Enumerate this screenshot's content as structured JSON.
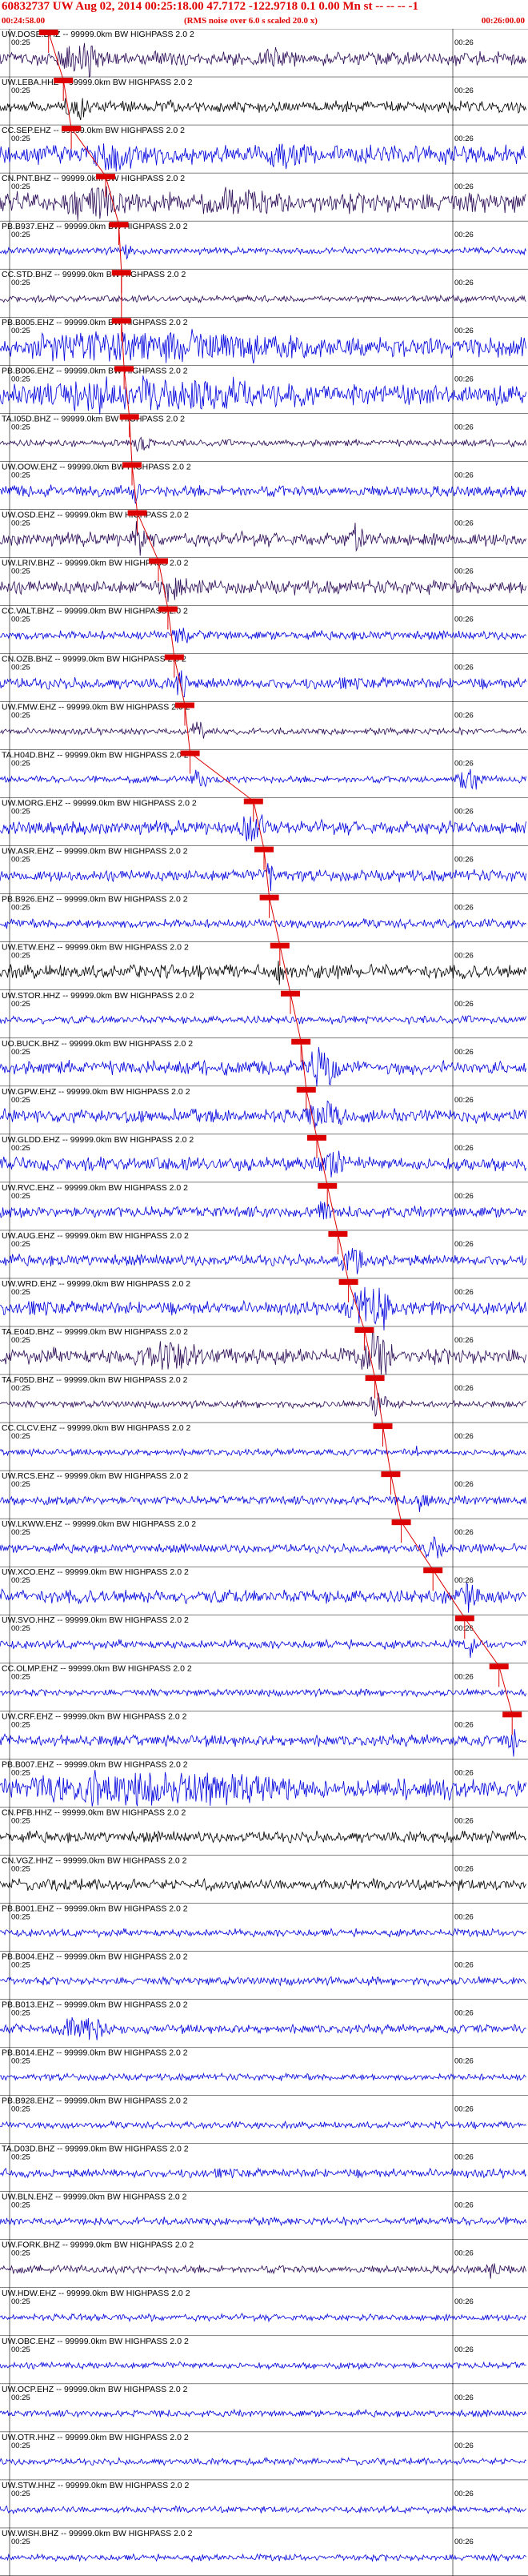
{
  "header": {
    "title": "60832737 UW Aug 02, 2014 00:25:18.00    47.7172 -122.9718  0.1 0.00 Mn st -- -- -- -1",
    "time_start": "00:24:58.00",
    "time_end": "00:26:00.00",
    "note": "(RMS noise over 6.0 s scaled 20.0 x)"
  },
  "chart_data": {
    "type": "line",
    "title": "60832737 UW Aug 02, 2014 00:25:18.00    47.7172 -122.9718  0.1 0.00 Mn st -- -- -- -1",
    "x_range": [
      "00:24:58.00",
      "00:26:00.00"
    ],
    "tick_labels": [
      "00:25",
      "00:26"
    ],
    "grid": true,
    "colors": {
      "blue": "#0000dd",
      "purple": "#2a0a55",
      "black": "#000000",
      "pick": "#dd0000"
    },
    "traces": [
      {
        "label": "UW.DOSE.BHZ -- 99999.0km BW  HIGHPASS  2.0  2",
        "color": "purple",
        "amp": 0.6,
        "pick": 0.092,
        "bursts": [
          [
            0.1,
            0.3,
            0.9
          ],
          [
            0.48,
            0.62,
            0.5
          ]
        ]
      },
      {
        "label": "UW.LEBA.HHZ -- 99999.0km BW  HIGHPASS  2.0  2",
        "color": "black",
        "amp": 0.5,
        "pick": 0.12,
        "bursts": [
          [
            0.12,
            0.22,
            1.0
          ]
        ]
      },
      {
        "label": "CC.SEP.EHZ -- 99999.0km BW  HIGHPASS  2.0  2",
        "color": "blue",
        "amp": 0.8,
        "pick": 0.135,
        "bursts": [
          [
            0.15,
            0.35,
            0.8
          ],
          [
            0.5,
            0.66,
            0.5
          ]
        ]
      },
      {
        "label": "CN.PNT.BHZ -- 99999.0km BW  HIGHPASS  2.0  2",
        "color": "purple",
        "amp": 0.9,
        "pick": 0.2,
        "bursts": [
          [
            0.12,
            0.32,
            1.0
          ],
          [
            0.4,
            0.6,
            0.7
          ]
        ]
      },
      {
        "label": "PB.B937.EHZ -- 99999.0km BW  HIGHPASS  2.0  2",
        "color": "blue",
        "amp": 0.3,
        "pick": 0.225,
        "bursts": [
          [
            0.23,
            0.27,
            0.6
          ]
        ]
      },
      {
        "label": "CC.STD.BHZ -- 99999.0km BW  HIGHPASS  2.0  2",
        "color": "purple",
        "amp": 0.3,
        "pick": 0.23,
        "bursts": []
      },
      {
        "label": "PB.B005.EHZ -- 99999.0km BW  HIGHPASS  2.0  2",
        "color": "blue",
        "amp": 0.9,
        "pick": 0.23,
        "bursts": [
          [
            0.05,
            0.95,
            0.7
          ]
        ]
      },
      {
        "label": "PB.B006.EHZ -- 99999.0km BW  HIGHPASS  2.0  2",
        "color": "blue",
        "amp": 0.9,
        "pick": 0.235,
        "bursts": [
          [
            0.05,
            0.95,
            0.7
          ]
        ]
      },
      {
        "label": "TA.I05D.BHZ -- 99999.0km BW  HIGHPASS  2.0  2",
        "color": "purple",
        "amp": 0.3,
        "pick": 0.245,
        "bursts": [
          [
            0.25,
            0.32,
            0.6
          ]
        ]
      },
      {
        "label": "UW.OOW.EHZ -- 99999.0km BW  HIGHPASS  2.0  2",
        "color": "blue",
        "amp": 0.5,
        "pick": 0.25,
        "bursts": [
          [
            0.25,
            0.28,
            2.0
          ]
        ]
      },
      {
        "label": "UW.OSD.EHZ -- 99999.0km BW  HIGHPASS  2.0  2",
        "color": "purple",
        "amp": 0.6,
        "pick": 0.26,
        "bursts": [
          [
            0.25,
            0.3,
            1.3
          ],
          [
            0.65,
            0.72,
            1.0
          ]
        ]
      },
      {
        "label": "UW.LRIV.BHZ -- 99999.0km BW  HIGHPASS  2.0  2",
        "color": "purple",
        "amp": 0.6,
        "pick": 0.3,
        "bursts": [
          [
            0.3,
            0.4,
            1.2
          ]
        ]
      },
      {
        "label": "CC.VALT.BHZ -- 99999.0km BW  HIGHPASS  2.0  2",
        "color": "blue",
        "amp": 0.4,
        "pick": 0.318,
        "bursts": [
          [
            0.32,
            0.4,
            0.6
          ]
        ]
      },
      {
        "label": "CN.OZB.BHZ -- 99999.0km BW  HIGHPASS  2.0  2",
        "color": "blue",
        "amp": 0.5,
        "pick": 0.33,
        "bursts": [
          [
            0.33,
            0.38,
            1.3
          ]
        ]
      },
      {
        "label": "UW.FMW.EHZ -- 99999.0km BW  HIGHPASS  2.0  2",
        "color": "purple",
        "amp": 0.3,
        "pick": 0.35,
        "bursts": [
          [
            0.36,
            0.41,
            0.9
          ]
        ]
      },
      {
        "label": "TA.H04D.BHZ -- 99999.0km BW  HIGHPASS  2.0  2",
        "color": "blue",
        "amp": 0.3,
        "pick": 0.36,
        "bursts": [
          [
            0.36,
            0.42,
            0.6
          ],
          [
            0.86,
            0.96,
            0.9
          ]
        ]
      },
      {
        "label": "UW.MORG.EHZ -- 99999.0km BW  HIGHPASS  2.0  2",
        "color": "blue",
        "amp": 0.6,
        "pick": 0.48,
        "bursts": [
          [
            0.45,
            0.55,
            0.9
          ]
        ]
      },
      {
        "label": "UW.ASR.EHZ -- 99999.0km BW  HIGHPASS  2.0  2",
        "color": "blue",
        "amp": 0.5,
        "pick": 0.5,
        "bursts": [
          [
            0.5,
            0.53,
            1.6
          ]
        ]
      },
      {
        "label": "PB.B926.EHZ -- 99999.0km BW  HIGHPASS  2.0  2",
        "color": "blue",
        "amp": 0.4,
        "pick": 0.51,
        "bursts": []
      },
      {
        "label": "UW.ETW.EHZ -- 99999.0km BW  HIGHPASS  2.0  2",
        "color": "black",
        "amp": 0.6,
        "pick": 0.53,
        "bursts": [
          [
            0.52,
            0.56,
            0.7
          ]
        ]
      },
      {
        "label": "UW.STOR.HHZ -- 99999.0km BW  HIGHPASS  2.0  2",
        "color": "blue",
        "amp": 0.35,
        "pick": 0.55,
        "bursts": []
      },
      {
        "label": "UO.BUCK.BHZ -- 99999.0km BW  HIGHPASS  2.0  2",
        "color": "blue",
        "amp": 0.6,
        "pick": 0.57,
        "bursts": [
          [
            0.57,
            0.7,
            1.3
          ]
        ]
      },
      {
        "label": "UW.GPW.EHZ -- 99999.0km BW  HIGHPASS  2.0  2",
        "color": "blue",
        "amp": 0.6,
        "pick": 0.58,
        "bursts": [
          [
            0.58,
            0.72,
            1.1
          ]
        ]
      },
      {
        "label": "UW.GLDD.EHZ -- 99999.0km BW  HIGHPASS  2.0  2",
        "color": "blue",
        "amp": 0.6,
        "pick": 0.6,
        "bursts": [
          [
            0.6,
            0.7,
            0.8
          ]
        ]
      },
      {
        "label": "UW.RVC.EHZ -- 99999.0km BW  HIGHPASS  2.0  2",
        "color": "blue",
        "amp": 0.5,
        "pick": 0.62,
        "bursts": [
          [
            0.6,
            0.65,
            0.8
          ]
        ]
      },
      {
        "label": "UW.AUG.EHZ -- 99999.0km BW  HIGHPASS  2.0  2",
        "color": "blue",
        "amp": 0.5,
        "pick": 0.64,
        "bursts": [
          [
            0.64,
            0.74,
            1.2
          ]
        ]
      },
      {
        "label": "UW.WRD.EHZ -- 99999.0km BW  HIGHPASS  2.0  2",
        "color": "blue",
        "amp": 0.6,
        "pick": 0.66,
        "bursts": [
          [
            0.65,
            0.85,
            1.4
          ]
        ]
      },
      {
        "label": "TA.E04D.BHZ -- 99999.0km BW  HIGHPASS  2.0  2",
        "color": "purple",
        "amp": 0.7,
        "pick": 0.69,
        "bursts": [
          [
            0.25,
            0.5,
            0.8
          ],
          [
            0.68,
            0.8,
            1.6
          ]
        ]
      },
      {
        "label": "TA.F05D.BHZ -- 99999.0km BW  HIGHPASS  2.0  2",
        "color": "purple",
        "amp": 0.3,
        "pick": 0.71,
        "bursts": [
          [
            0.7,
            0.76,
            1.2
          ]
        ]
      },
      {
        "label": "CC.CLCV.EHZ -- 99999.0km BW  HIGHPASS  2.0  2",
        "color": "blue",
        "amp": 0.3,
        "pick": 0.725,
        "bursts": [
          [
            0.78,
            0.8,
            0.6
          ]
        ]
      },
      {
        "label": "UW.RCS.EHZ -- 99999.0km BW  HIGHPASS  2.0  2",
        "color": "blue",
        "amp": 0.4,
        "pick": 0.74,
        "bursts": [
          [
            0.78,
            0.84,
            0.7
          ]
        ]
      },
      {
        "label": "UW.LKWW.EHZ -- 99999.0km BW  HIGHPASS  2.0  2",
        "color": "blue",
        "amp": 0.4,
        "pick": 0.76,
        "bursts": [
          [
            0.8,
            0.88,
            0.9
          ]
        ]
      },
      {
        "label": "UW.XCO.EHZ -- 99999.0km BW  HIGHPASS  2.0  2",
        "color": "blue",
        "amp": 0.6,
        "pick": 0.82,
        "bursts": [
          [
            0.85,
            0.95,
            1.0
          ]
        ]
      },
      {
        "label": "UW.SVO.HHZ -- 99999.0km BW  HIGHPASS  2.0  2",
        "color": "blue",
        "amp": 0.4,
        "pick": 0.88,
        "bursts": [
          [
            0.88,
            0.92,
            0.8
          ]
        ]
      },
      {
        "label": "CC.OLMP.EHZ -- 99999.0km BW  HIGHPASS  2.0  2",
        "color": "blue",
        "amp": 0.3,
        "pick": 0.945,
        "bursts": []
      },
      {
        "label": "UW.CRF.EHZ -- 99999.0km BW  HIGHPASS  2.0  2",
        "color": "blue",
        "amp": 0.5,
        "pick": 0.97,
        "bursts": [
          [
            0.96,
            1.0,
            1.2
          ]
        ]
      },
      {
        "label": "PB.B007.EHZ -- 99999.0km BW  HIGHPASS  2.0  2",
        "color": "blue",
        "amp": 0.9,
        "pick": null,
        "bursts": [
          [
            0.02,
            0.98,
            0.8
          ]
        ]
      },
      {
        "label": "CN.PFB.HHZ -- 99999.0km BW  HIGHPASS  2.0  2",
        "color": "black",
        "amp": 0.5,
        "pick": null,
        "bursts": []
      },
      {
        "label": "CN.VGZ.HHZ -- 99999.0km BW  HIGHPASS  2.0  2",
        "color": "black",
        "amp": 0.5,
        "pick": null,
        "bursts": []
      },
      {
        "label": "PB.B001.EHZ -- 99999.0km BW  HIGHPASS  2.0  2",
        "color": "blue",
        "amp": 0.35,
        "pick": null,
        "bursts": []
      },
      {
        "label": "PB.B004.EHZ -- 99999.0km BW  HIGHPASS  2.0  2",
        "color": "blue",
        "amp": 0.35,
        "pick": null,
        "bursts": []
      },
      {
        "label": "PB.B013.EHZ -- 99999.0km BW  HIGHPASS  2.0  2",
        "color": "blue",
        "amp": 0.4,
        "pick": null,
        "bursts": [
          [
            0.1,
            0.3,
            0.8
          ]
        ]
      },
      {
        "label": "PB.B014.EHZ -- 99999.0km BW  HIGHPASS  2.0  2",
        "color": "blue",
        "amp": 0.3,
        "pick": null,
        "bursts": []
      },
      {
        "label": "PB.B928.EHZ -- 99999.0km BW  HIGHPASS  2.0  2",
        "color": "blue",
        "amp": 0.3,
        "pick": null,
        "bursts": []
      },
      {
        "label": "TA.D03D.BHZ -- 99999.0km BW  HIGHPASS  2.0  2",
        "color": "blue",
        "amp": 0.4,
        "pick": null,
        "bursts": []
      },
      {
        "label": "UW.BLN.EHZ -- 99999.0km BW  HIGHPASS  2.0  2",
        "color": "blue",
        "amp": 0.35,
        "pick": null,
        "bursts": []
      },
      {
        "label": "UW.FORK.BHZ -- 99999.0km BW  HIGHPASS  2.0  2",
        "color": "purple",
        "amp": 0.35,
        "pick": null,
        "bursts": [
          [
            0.92,
            0.97,
            0.8
          ]
        ]
      },
      {
        "label": "UW.HDW.EHZ -- 99999.0km BW  HIGHPASS  2.0  2",
        "color": "blue",
        "amp": 0.3,
        "pick": null,
        "bursts": []
      },
      {
        "label": "UW.OBC.EHZ -- 99999.0km BW  HIGHPASS  2.0  2",
        "color": "blue",
        "amp": 0.3,
        "pick": null,
        "bursts": []
      },
      {
        "label": "UW.OCP.EHZ -- 99999.0km BW  HIGHPASS  2.0  2",
        "color": "blue",
        "amp": 0.3,
        "pick": null,
        "bursts": []
      },
      {
        "label": "UW.OTR.HHZ -- 99999.0km BW  HIGHPASS  2.0  2",
        "color": "blue",
        "amp": 0.3,
        "pick": null,
        "bursts": []
      },
      {
        "label": "UW.STW.HHZ -- 99999.0km BW  HIGHPASS  2.0  2",
        "color": "blue",
        "amp": 0.3,
        "pick": null,
        "bursts": []
      },
      {
        "label": "UW.WISH.BHZ -- 99999.0km BW  HIGHPASS  2.0  2",
        "color": "blue",
        "amp": 0.3,
        "pick": null,
        "bursts": []
      }
    ]
  }
}
